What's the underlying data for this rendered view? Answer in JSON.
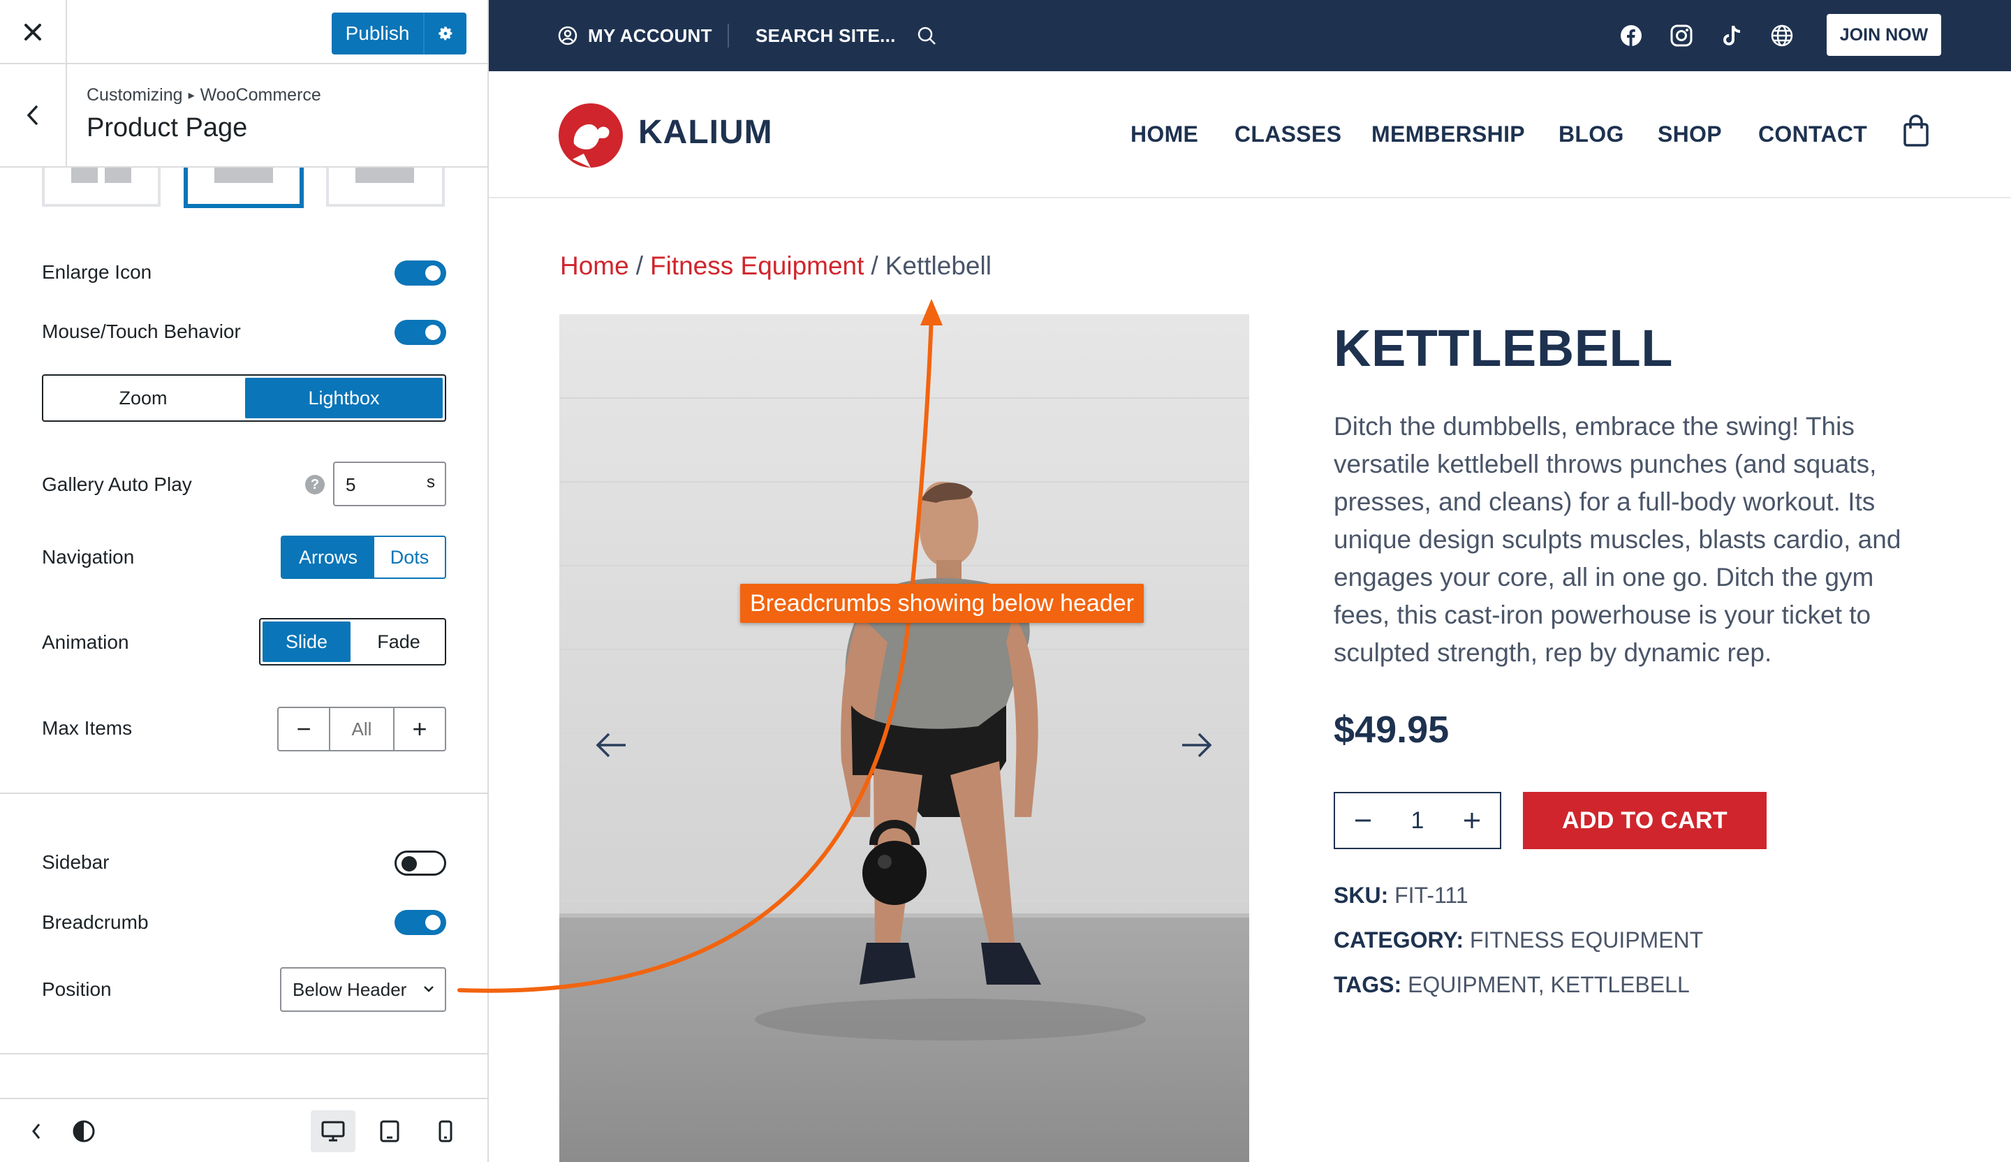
{
  "customizer": {
    "close_icon": "close-icon",
    "publish_label": "Publish",
    "breadcrumb_root": "Customizing",
    "breadcrumb_section": "WooCommerce",
    "panel_title": "Product Page",
    "rows": {
      "enlarge_icon": {
        "label": "Enlarge Icon",
        "enabled": true
      },
      "mouse_touch": {
        "label": "Mouse/Touch Behavior",
        "enabled": true
      },
      "zoom_lightbox": {
        "options": [
          "Zoom",
          "Lightbox"
        ],
        "selected": "Lightbox"
      },
      "gallery_autoplay": {
        "label": "Gallery Auto Play",
        "value": "5",
        "unit": "s"
      },
      "navigation": {
        "label": "Navigation",
        "options": [
          "Arrows",
          "Dots"
        ],
        "selected": "Arrows"
      },
      "animation": {
        "label": "Animation",
        "options": [
          "Slide",
          "Fade"
        ],
        "selected": "Slide"
      },
      "max_items": {
        "label": "Max Items",
        "value": "All",
        "minus": "−",
        "plus": "+"
      },
      "sidebar": {
        "label": "Sidebar",
        "enabled": false
      },
      "breadcrumb": {
        "label": "Breadcrumb",
        "enabled": true
      },
      "position": {
        "label": "Position",
        "value": "Below Header"
      }
    }
  },
  "site": {
    "topbar": {
      "my_account": "MY ACCOUNT",
      "search": "SEARCH SITE...",
      "join": "JOIN NOW",
      "social_icons": [
        "facebook-icon",
        "instagram-icon",
        "tiktok-icon",
        "globe-icon"
      ]
    },
    "logo_text": "KALIUM",
    "nav": [
      "HOME",
      "CLASSES",
      "MEMBERSHIP",
      "BLOG",
      "SHOP",
      "CONTACT"
    ],
    "breadcrumbs": {
      "home": "Home",
      "category": "Fitness Equipment",
      "current": "Kettlebell",
      "sep": "/"
    },
    "product": {
      "title": "KETTLEBELL",
      "description": "Ditch the dumbbells, embrace the swing! This versatile kettlebell throws punches (and squats, presses, and cleans) for a full-body workout. Its unique design sculpts muscles, blasts cardio, and engages your core, all in one go. Ditch the gym fees, this cast-iron powerhouse is your ticket to sculpted strength, rep by dynamic rep.",
      "price": "$49.95",
      "quantity": "1",
      "add_to_cart": "ADD TO CART",
      "sku_label": "SKU:",
      "sku": "FIT-111",
      "category_label": "CATEGORY:",
      "category": "FITNESS EQUIPMENT",
      "tags_label": "TAGS:",
      "tags": "EQUIPMENT, KETTLEBELL"
    }
  },
  "annotation": {
    "text": "Breadcrumbs showing below header"
  },
  "colors": {
    "accent_blue": "#0a75b8",
    "navy": "#1e3250",
    "brand_red": "#d0252c",
    "annotation_orange": "#f2640f"
  }
}
